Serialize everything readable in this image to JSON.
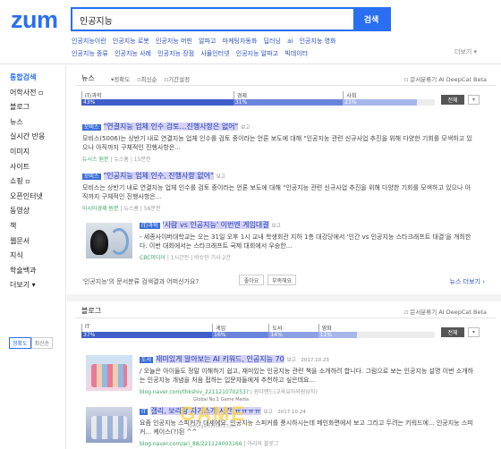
{
  "header": {
    "logo": "zum",
    "search_value": "인공지능",
    "search_button": "검색",
    "related_row1": [
      "인공지능이란",
      "인공지능 로봇",
      "인공지능 머핀",
      "알파고",
      "마케팅자동화",
      "딥러닝",
      "ai",
      "인공지능 영화"
    ],
    "related_row2": [
      "인공지능 종류",
      "인공지능 사례",
      "인공지능 장점",
      "사물인터넷",
      "인공지능 알파고",
      "빅데이터"
    ],
    "more_related": "더보기 ▾"
  },
  "sidebar": {
    "items": [
      "통합검색",
      "어학사전 ▫",
      "블로그",
      "뉴스",
      "실시간 반응",
      "이미지",
      "사이트",
      "쇼핑 ▫",
      "오픈인터넷",
      "동영상",
      "책",
      "웹문서",
      "지식",
      "학술백과",
      "더보기 ▾"
    ],
    "sort_options": [
      "정확도",
      "최신순"
    ]
  },
  "news": {
    "title": "뉴스",
    "options": [
      "▾정확도",
      "▫최신순",
      "▫기간설정"
    ],
    "classifier": "▫ 문서분류기 AI DeepCat Beta",
    "dist_labels": [
      "IT/과학",
      "경제",
      "사회"
    ],
    "dist_pcts": [
      "43%",
      "31%",
      "21%"
    ],
    "all_button": "전체",
    "arrow": "▾",
    "colors": [
      "#3f5ec9",
      "#6b84db",
      "#a7b7ec"
    ],
    "results": [
      {
        "badge": "모비스",
        "title": "\"연결지능 업체 인수 검토…진행사항은 없어\"",
        "badge2": "보고",
        "desc": "모비스(5006)는 상반기 내로 연결지능 업체 인수를 검토 중이라는 언론 보도에 대해 \"인공지능 관련 신규사업 추진을 위해 다양한 기회를 모색하고 있으나 아직까지 구체적인 진행사항은...",
        "meta_src": "뉴시스 원문",
        "meta_rest": "| 뉴스홈 | 15분전"
      },
      {
        "badge": "모비스",
        "title": "\"인공지능 업체 인수, 진행사항 없어\"",
        "badge2": "보고",
        "desc": "모비스는 상반기 내로 연결지능 업체 인수를 검토 중이라는 언론 보도에 대해 \"인공지능 관련 신규사업 추진을 위해 다양한 기회를 모색하고 있으나 아직까지 구체적인 진행사항은...",
        "meta_src": "아시아경제 원문",
        "meta_rest": "| 뉴스홈 | 56분전"
      },
      {
        "badge": "IT/과학",
        "title": "'사람 vs 인공지능' 이번엔 게임대결",
        "badge2": "보고",
        "desc": "- 세종사이버대학교는 오는 31일 오후 1시 교내 학생회관 지하 1층 대강당에서 '인간 vs 인공지능 스타크래프트 대결'을 개최한다. 이번 대회에서는 스타크래프트 국제 대회에서 우승한...",
        "meta_src": "CBC미디어",
        "meta_rest": "| 1시간전 | 비슷한 기사 2건"
      }
    ],
    "feedback_q": "'인공지능'의 문서분류 검색결과 어떠신가요?",
    "good": "좋아요",
    "bad": "부족해요",
    "more": "뉴스 더보기 ›"
  },
  "blog": {
    "title": "블로그",
    "classifier": "▫ 문서분류기 AI DeepCat Beta",
    "dist_labels": [
      "IT",
      "게임",
      "도서",
      "영화"
    ],
    "dist_pcts": [
      "37%",
      "16%",
      "14%",
      "11%"
    ],
    "all_button": "전체",
    "arrow": "▾",
    "colors": [
      "#3f5ec9",
      "#6b84db",
      "#8da0e3",
      "#a7b7ec"
    ],
    "results": [
      {
        "badge": "도서",
        "title": "재미있게 알아보는 AI 키워드, 인공지능 70",
        "badge2": "보고",
        "date": "2017.10.23",
        "desc": "/ 오늘은 아이들도 정말 이해하기 쉽고, 재미있는 인공지능 관련 책을 소개하려 합니다. 그림으로 보는 인공지능 설명 이번 소개하는 인공지능 개념을 처음 접하는 입문자들에게 추천하고 싶은데요...",
        "meta": "blog.naver.com/thkshiv_221121070253?",
        "meta2": "원더랜드(교육유아와원남자)"
      },
      {
        "badge": "IT",
        "title": "갤리, 보리랑 자기소개 시간 ㅠㅠㅠㅠ",
        "badge2": "보고",
        "date": "2017.10.24",
        "desc": "요즘 인공지능 스피커가 대세에요. 인공지능 스피커를 풍시하시는데 메인화면에서 보고 그리고 두려는 키워드에... 인공지능 스피커... 케이스(?)된 ^^",
        "meta": "blog.naver.com/ari_88/221124003166",
        "meta2": "아리의 블로그"
      }
    ]
  },
  "watermark": {
    "top": "Global No.1 Game Media",
    "main": "GAME",
    "dots": "····",
    "domain": "www.gamemeca.com"
  }
}
